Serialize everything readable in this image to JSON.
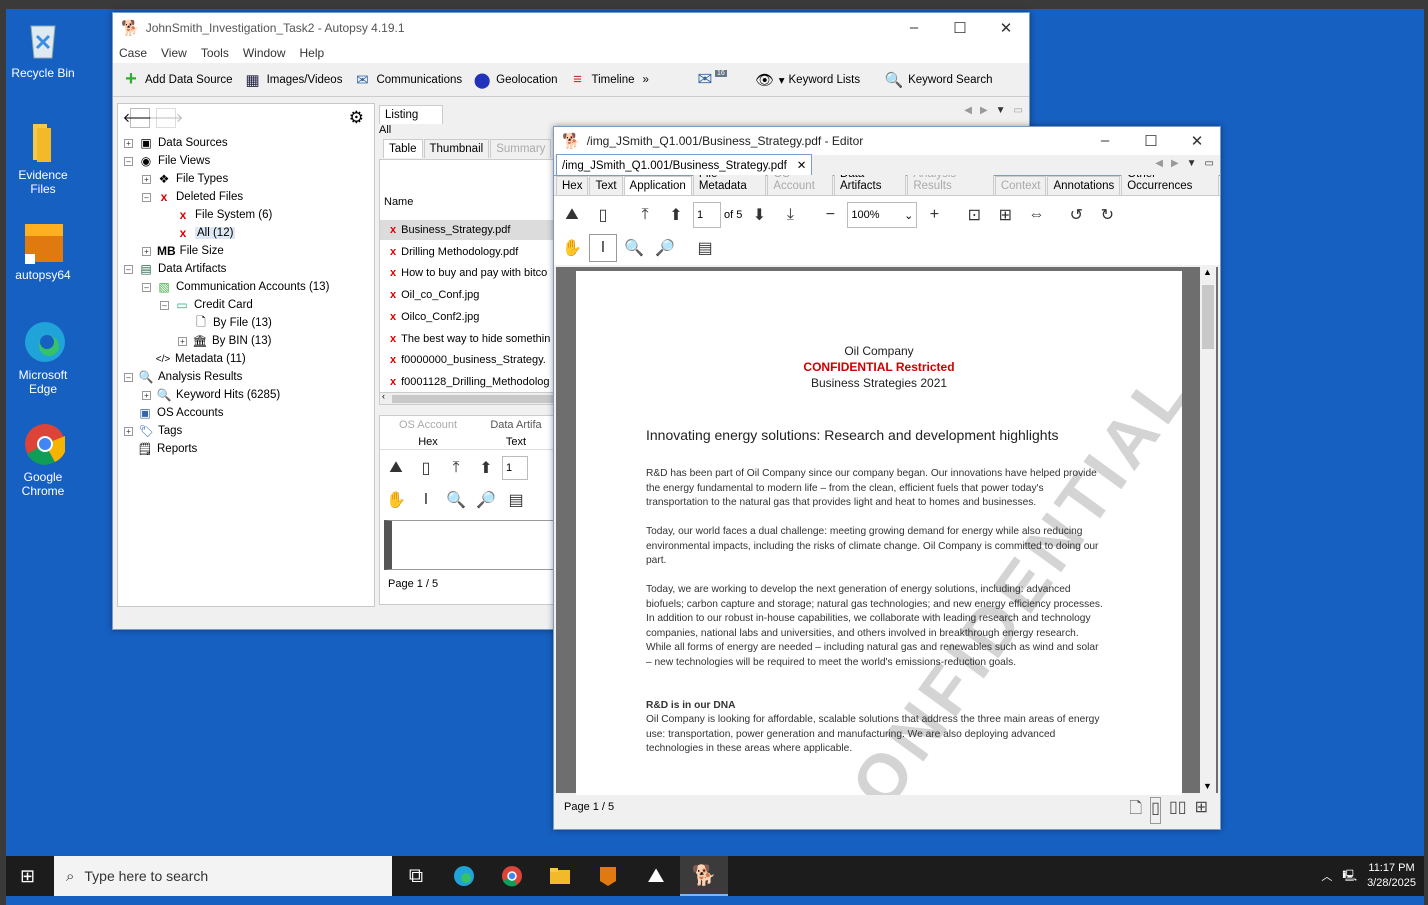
{
  "desktop": {
    "icons": [
      {
        "label": "Recycle Bin"
      },
      {
        "label": "Evidence Files"
      },
      {
        "label": "autopsy64"
      },
      {
        "label": "Microsoft Edge"
      },
      {
        "label": "Google Chrome"
      }
    ]
  },
  "main_window": {
    "title": "JohnSmith_Investigation_Task2 - Autopsy 4.19.1",
    "menu": [
      "Case",
      "View",
      "Tools",
      "Window",
      "Help"
    ],
    "toolbar": {
      "add_data_source": "Add Data Source",
      "images_videos": "Images/Videos",
      "communications": "Communications",
      "geolocation": "Geolocation",
      "timeline": "Timeline",
      "mail_badge": "16",
      "keyword_lists": "Keyword Lists",
      "keyword_search": "Keyword Search"
    },
    "tree": [
      "Data Sources",
      "File Views",
      "File Types",
      "Deleted Files",
      "File System (6)",
      "All (12)",
      "File Size",
      "Data Artifacts",
      "Communication Accounts (13)",
      "Credit Card",
      "By File (13)",
      "By BIN (13)",
      "Metadata (11)",
      "Analysis Results",
      "Keyword Hits (6285)",
      "OS Accounts",
      "Tags",
      "Reports"
    ],
    "mb_label": "MB",
    "listing": {
      "tab": "Listing",
      "subtitle": "All",
      "view_tabs": [
        "Table",
        "Thumbnail",
        "Summary"
      ],
      "col_name": "Name",
      "files": [
        "Business_Strategy.pdf",
        "Drilling Methodology.pdf",
        "How to buy and pay with bitco",
        "Oil_co_Conf.jpg",
        "Oilco_Conf2.jpg",
        "The best way to hide somethin",
        "f0000000_business_Strategy.",
        "f0001128_Drilling_Methodolog"
      ],
      "lower_tabs": [
        "OS Account",
        "Data Artifa",
        "Hex",
        "Text"
      ],
      "page_input": "1",
      "page_status": "Page 1 / 5"
    }
  },
  "editor": {
    "title": "/img_JSmith_Q1.001/Business_Strategy.pdf - Editor",
    "doc_tab": "/img_JSmith_Q1.001/Business_Strategy.pdf",
    "tabs": [
      "Hex",
      "Text",
      "Application",
      "File Metadata",
      "OS Account",
      "Data Artifacts",
      "Analysis Results",
      "Context",
      "Annotations",
      "Other Occurrences"
    ],
    "page_input": "1",
    "page_of": "of 5",
    "zoom": "100%",
    "page_status": "Page 1 / 5",
    "pdf": {
      "company": "Oil Company",
      "confidential": "CONFIDENTIAL Restricted",
      "subtitle": "Business Strategies 2021",
      "heading": "Innovating energy solutions: Research and development highlights",
      "p1": "R&D has been part of Oil Company  since our company began. Our innovations have helped provide the energy fundamental to modern life – from the clean, efficient fuels that power today's transportation to the natural gas that provides light and heat to homes and businesses.",
      "p2": "Today, our world faces a dual challenge: meeting growing demand for energy while also reducing environmental impacts, including the risks of climate change. Oil Company is committed to doing our part.",
      "p3": "Today, we are working to develop the next generation of energy solutions, including: advanced biofuels; carbon capture and storage; natural gas technologies; and new energy efficiency processes. In addition to our robust in-house capabilities, we collaborate with leading research and technology companies, national labs and universities, and others involved in breakthrough energy research. While all forms of energy are needed – including natural gas and renewables such as wind and solar – new technologies will be required to meet the world's emissions-reduction goals.",
      "section": "R&D is in our DNA",
      "p4": "Oil Company is looking for affordable, scalable solutions that address the three main areas of energy use: transportation, power generation and manufacturing. We are also deploying advanced technologies in these areas where applicable.",
      "watermark": "CONFIDENTIAL"
    }
  },
  "taskbar": {
    "search_placeholder": "Type here to search",
    "time": "11:17 PM",
    "date": "3/28/2025"
  },
  "colors": {
    "desktop": "#1660c2",
    "accent": "#d00000"
  }
}
